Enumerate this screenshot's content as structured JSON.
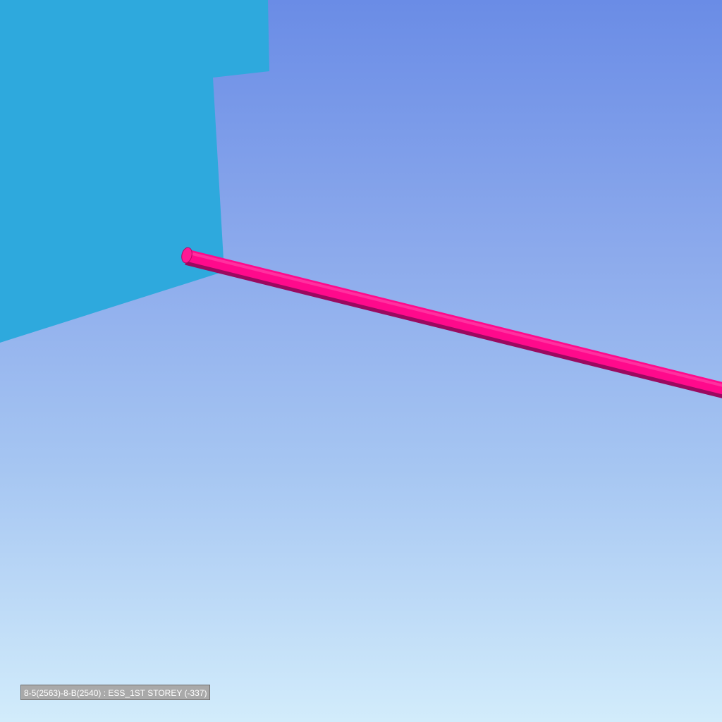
{
  "viewport": {
    "background_top": "#6a8ce6",
    "background_bottom": "#d2ecfb"
  },
  "scene": {
    "wall_color": "#2ea9dd",
    "pipe_color": "#ff0a8c",
    "pipe_shadow_color": "#8a0a55"
  },
  "status": {
    "label": "8-5(2563)-8-B(2540) : ESS_1ST STOREY (-337)"
  }
}
